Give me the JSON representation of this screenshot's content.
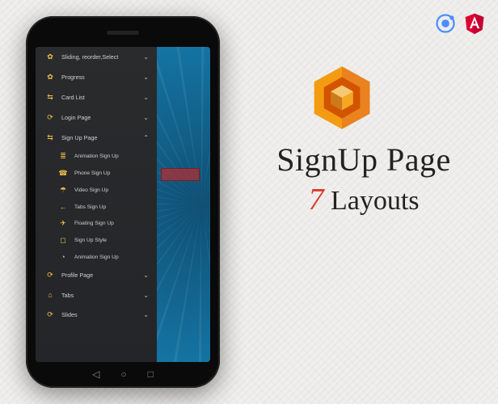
{
  "menu": [
    {
      "icon": "✿",
      "label": "Sliding, reorder,Select",
      "expanded": false
    },
    {
      "icon": "✿",
      "label": "Progress",
      "expanded": false
    },
    {
      "icon": "⇆",
      "label": "Card List",
      "expanded": false
    },
    {
      "icon": "⟳",
      "label": "Login Page",
      "expanded": false
    },
    {
      "icon": "⇆",
      "label": "Sign Up Page",
      "expanded": true
    },
    {
      "icon": "⟳",
      "label": "Profile Page",
      "expanded": false
    },
    {
      "icon": "⌂",
      "label": "Tabs",
      "expanded": false
    },
    {
      "icon": "⟳",
      "label": "Slides",
      "expanded": false
    }
  ],
  "submenu": [
    {
      "icon": "≣",
      "label": "Animation Sign Up"
    },
    {
      "icon": "☎",
      "label": "Phone Sign Up"
    },
    {
      "icon": "☂",
      "label": "Video Sign Up"
    },
    {
      "icon": "←",
      "label": "Tabs Sign Up"
    },
    {
      "icon": "✈",
      "label": "Floating Sign Up"
    },
    {
      "icon": "◻",
      "label": "Sign Up Style"
    },
    {
      "icon": "◔",
      "label": "Animation Sign Up"
    }
  ],
  "marketing": {
    "line1": "SignUp Page",
    "count": "7",
    "line2_word": " Layouts"
  },
  "brand_logos": {
    "ionic": "ionic",
    "angular": "angular"
  }
}
